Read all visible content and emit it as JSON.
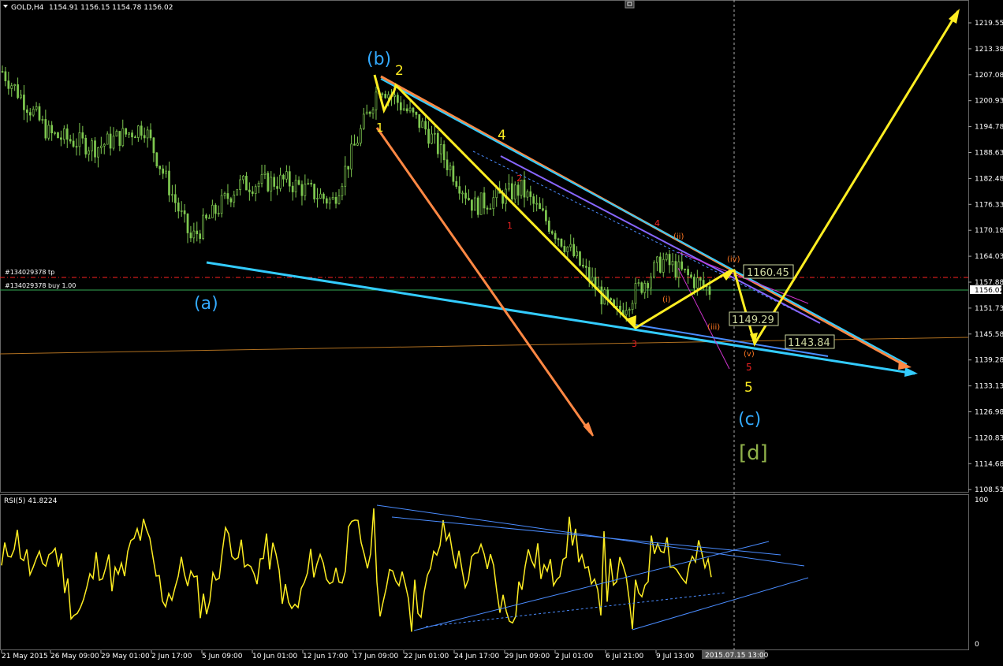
{
  "window": {
    "symbol_label": "GOLD,H4",
    "ohlc": "1154.91 1156.15 1154.78 1156.02",
    "maximize_icon": "window-restore-icon"
  },
  "price_axis": {
    "ticks": [
      "1219.55",
      "1213.38",
      "1207.08",
      "1200.93",
      "1194.78",
      "1188.63",
      "1182.48",
      "1176.33",
      "1170.18",
      "1164.03",
      "1157.88",
      "1151.73",
      "1145.58",
      "1139.28",
      "1133.13",
      "1126.98",
      "1120.83",
      "1114.68",
      "1108.53"
    ],
    "current_price": "1156.02"
  },
  "time_axis": {
    "labels": [
      "21 May 2015",
      "26 May 09:00",
      "29 May 01:00",
      "2 Jun 17:00",
      "5 Jun 09:00",
      "10 Jun 01:00",
      "12 Jun 17:00",
      "17 Jun 09:00",
      "22 Jun 01:00",
      "24 Jun 17:00",
      "29 Jun 09:00",
      "2 Jul 01:00",
      "6 Jul 21:00",
      "9 Jul 13:00"
    ],
    "cursor_label": "2015.07.15 13:00"
  },
  "order_lines": {
    "tp_label": "#134029378 tp",
    "buy_label": "#134029378 buy 1.00"
  },
  "price_boxes": [
    "1160.45",
    "1149.29",
    "1143.84"
  ],
  "wave_labels": {
    "a": "(a)",
    "b": "(b)",
    "c": "(c)",
    "d": "[d]",
    "y1": "1",
    "y2": "2",
    "y4": "4",
    "y5": "5",
    "r1": "1",
    "r2": "2",
    "r3": "3",
    "r4": "4",
    "r5": "5",
    "i": "(i)",
    "ii": "(ii)",
    "iii": "(iii)",
    "iv": "(iv)",
    "v": "(v)"
  },
  "rsi": {
    "label": "RSI(5) 41.8224",
    "top": "100",
    "bottom": "0"
  },
  "chart_data": {
    "type": "candlestick",
    "title": "GOLD,H4",
    "ylim": [
      1105.5,
      1224
    ],
    "series": [
      {
        "name": "GOLD,H4",
        "approx_close_path": [
          {
            "x": "21 May 2015",
            "y": 1208
          },
          {
            "x": "26 May 09:00",
            "y": 1193
          },
          {
            "x": "29 May 01:00",
            "y": 1190
          },
          {
            "x": "2 Jun 17:00",
            "y": 1195
          },
          {
            "x": "5 Jun 09:00",
            "y": 1168
          },
          {
            "x": "10 Jun 01:00",
            "y": 1181
          },
          {
            "x": "12 Jun 17:00",
            "y": 1182
          },
          {
            "x": "17 Jun 09:00",
            "y": 1177
          },
          {
            "x": "18 Jun",
            "y": 1205
          },
          {
            "x": "22 Jun 01:00",
            "y": 1194
          },
          {
            "x": "24 Jun 17:00",
            "y": 1176
          },
          {
            "x": "29 Jun 09:00",
            "y": 1180
          },
          {
            "x": "2 Jul 01:00",
            "y": 1166
          },
          {
            "x": "6 Jul 21:00",
            "y": 1150
          },
          {
            "x": "9 Jul 13:00",
            "y": 1163
          },
          {
            "x": "10 Jul",
            "y": 1156
          }
        ]
      }
    ],
    "rsi_period": 5,
    "rsi_last": 41.8224
  },
  "colors": {
    "candle": "#7ec850",
    "yellow": "#ffee22",
    "orange": "#ff8844",
    "cyan": "#33ccff",
    "blue": "#4a8cff",
    "purple": "#8866ff",
    "magenta": "#cc33cc",
    "tp_line": "#ff2222",
    "buy_line": "#33aa55",
    "horiz_orange": "#b07020",
    "box": "#cdd7a0"
  }
}
